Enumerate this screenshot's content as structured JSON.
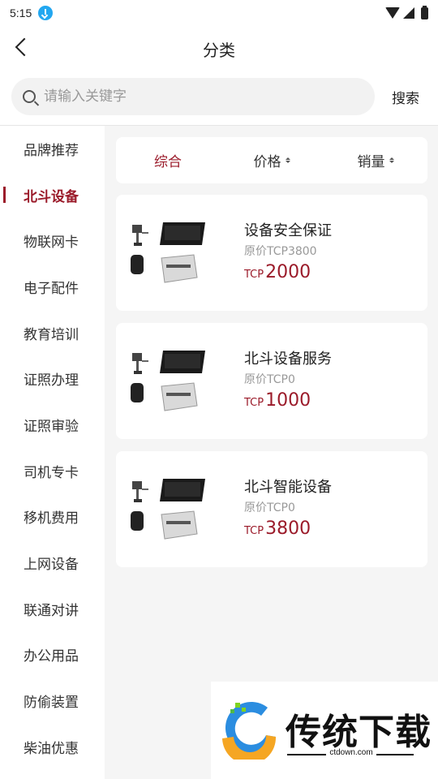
{
  "status_bar": {
    "time": "5:15"
  },
  "header": {
    "title": "分类"
  },
  "search": {
    "placeholder": "请输入关键字",
    "button_label": "搜索"
  },
  "sidebar": {
    "items": [
      {
        "label": "品牌推荐",
        "active": false
      },
      {
        "label": "北斗设备",
        "active": true
      },
      {
        "label": "物联网卡",
        "active": false
      },
      {
        "label": "电子配件",
        "active": false
      },
      {
        "label": "教育培训",
        "active": false
      },
      {
        "label": "证照办理",
        "active": false
      },
      {
        "label": "证照审验",
        "active": false
      },
      {
        "label": "司机专卡",
        "active": false
      },
      {
        "label": "移机费用",
        "active": false
      },
      {
        "label": "上网设备",
        "active": false
      },
      {
        "label": "联通对讲",
        "active": false
      },
      {
        "label": "办公用品",
        "active": false
      },
      {
        "label": "防偷装置",
        "active": false
      },
      {
        "label": "柴油优惠",
        "active": false
      }
    ]
  },
  "sort_bar": {
    "items": [
      {
        "label": "综合",
        "active": true
      },
      {
        "label": "价格",
        "active": false
      },
      {
        "label": "销量",
        "active": false
      }
    ]
  },
  "products": [
    {
      "name": "设备安全保证",
      "original_price": "原价TCP3800",
      "price_unit": "TCP",
      "price_value": "2000"
    },
    {
      "name": "北斗设备服务",
      "original_price": "原价TCP0",
      "price_unit": "TCP",
      "price_value": "1000"
    },
    {
      "name": "北斗智能设备",
      "original_price": "原价TCP0",
      "price_unit": "TCP",
      "price_value": "3800"
    }
  ],
  "watermark": {
    "title": "传统下载",
    "url": "ctdown.com"
  },
  "colors": {
    "accent": "#9b1b2a",
    "main_bg": "#f5f5f5",
    "search_bg": "#f2f2f2"
  },
  "icons": [
    "download-icon",
    "wifi-icon",
    "signal-icon",
    "battery-icon",
    "back-icon",
    "search-icon",
    "sort-arrows-icon"
  ]
}
